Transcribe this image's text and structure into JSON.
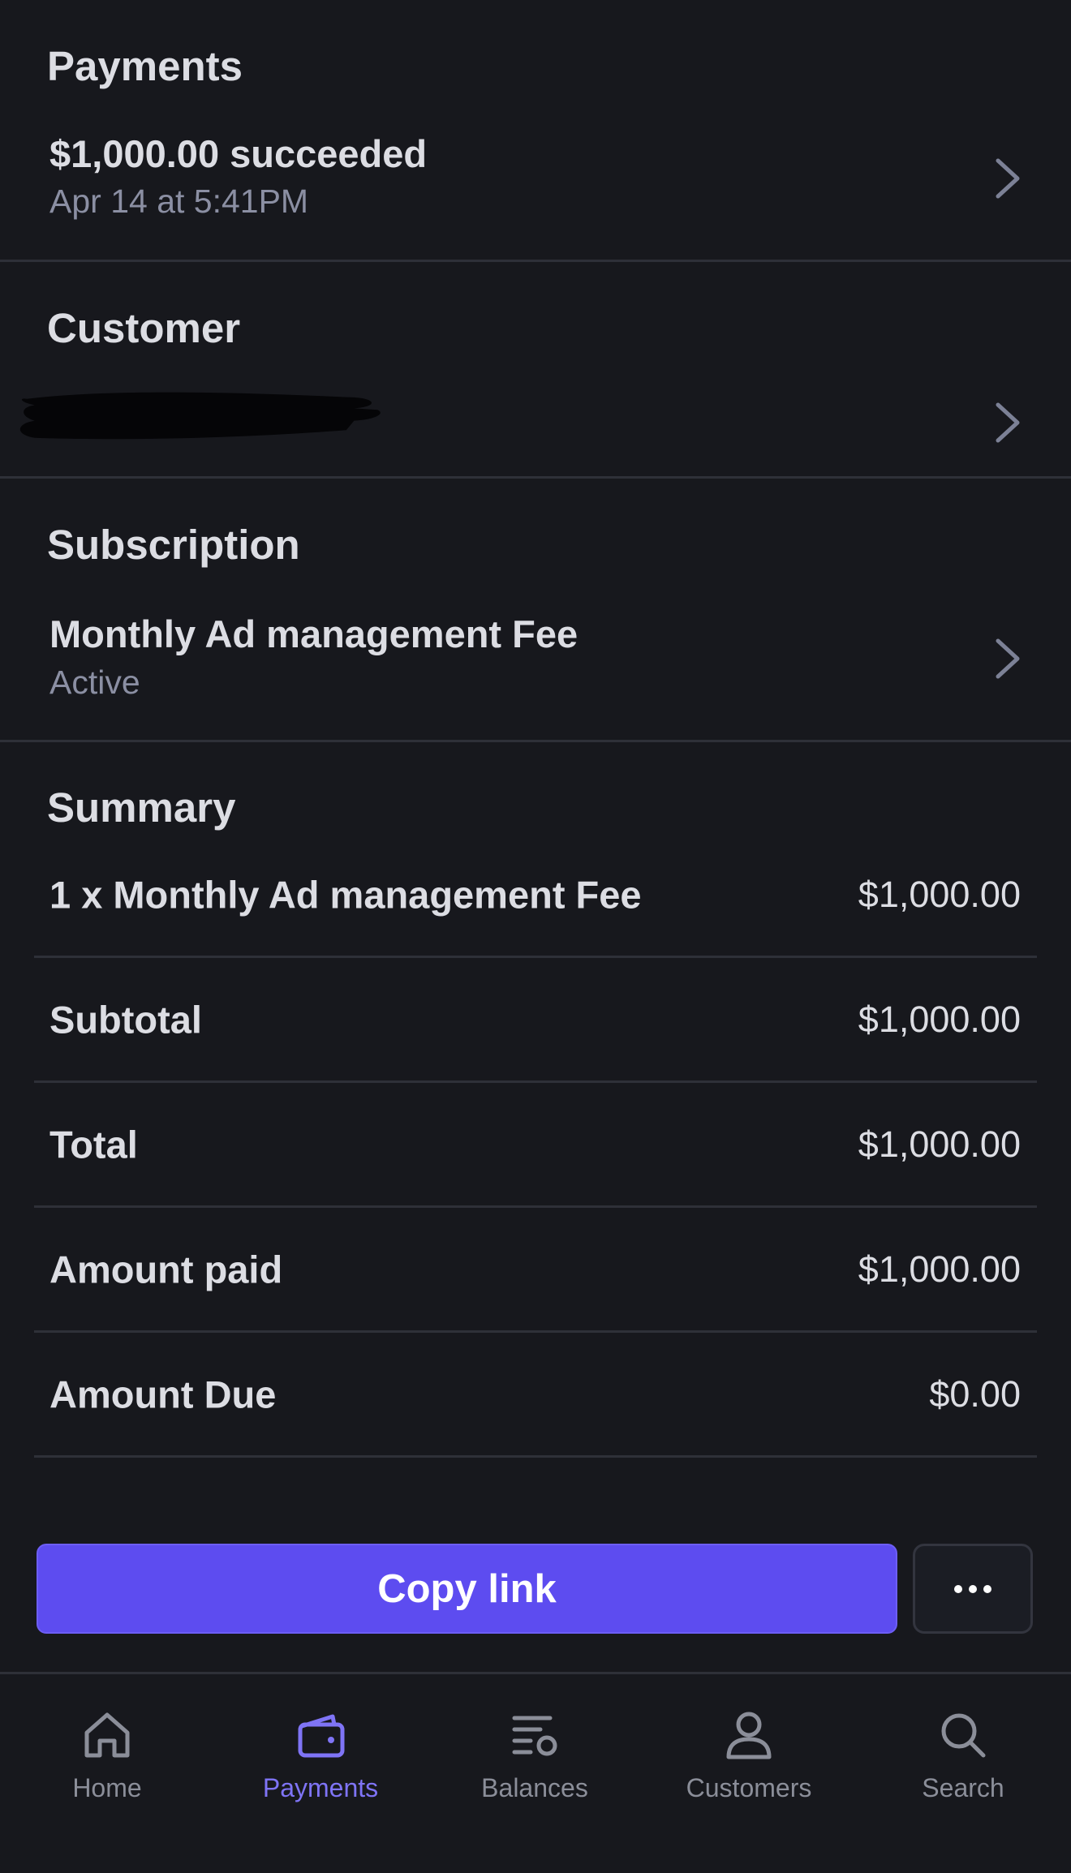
{
  "payments": {
    "title": "Payments",
    "amount_status": "$1,000.00 succeeded",
    "date": "Apr 14 at 5:41PM"
  },
  "customer": {
    "title": "Customer"
  },
  "subscription": {
    "title": "Subscription",
    "name": "Monthly Ad management Fee",
    "status": "Active"
  },
  "summary": {
    "title": "Summary",
    "lines": [
      {
        "label": "1 x Monthly Ad management Fee",
        "value": "$1,000.00"
      },
      {
        "label": "Subtotal",
        "value": "$1,000.00"
      },
      {
        "label": "Total",
        "value": "$1,000.00"
      },
      {
        "label": "Amount paid",
        "value": "$1,000.00"
      },
      {
        "label": "Amount Due",
        "value": "$0.00"
      }
    ]
  },
  "actions": {
    "copy_link": "Copy link",
    "more_icon": "ellipsis-icon"
  },
  "tabs": [
    {
      "label": "Home",
      "icon": "home-icon",
      "active": false
    },
    {
      "label": "Payments",
      "icon": "wallet-icon",
      "active": true
    },
    {
      "label": "Balances",
      "icon": "balances-icon",
      "active": false
    },
    {
      "label": "Customers",
      "icon": "person-icon",
      "active": false
    },
    {
      "label": "Search",
      "icon": "search-icon",
      "active": false
    }
  ],
  "colors": {
    "background": "#17181d",
    "accent": "#5d4cf0",
    "active_tab": "#7f74f6",
    "muted_text": "#8b8fa3"
  }
}
